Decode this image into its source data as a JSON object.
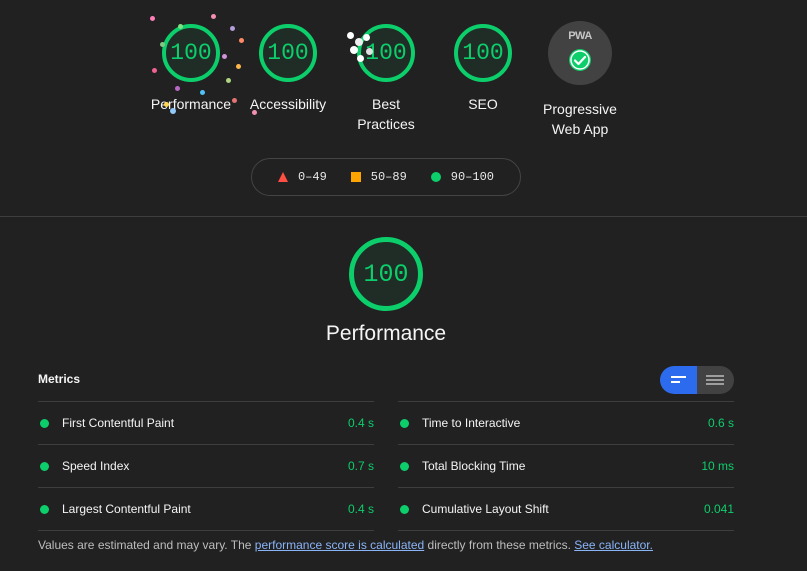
{
  "gauges": [
    {
      "score": "100",
      "label": "Performance"
    },
    {
      "score": "100",
      "label": "Accessibility"
    },
    {
      "score": "100",
      "label": "Best Practices"
    },
    {
      "score": "100",
      "label": "SEO"
    }
  ],
  "pwa": {
    "badge_text": "PWA",
    "label": "Progressive Web App",
    "icon": "check-icon"
  },
  "legend": [
    {
      "icon": "triangle-icon",
      "range": "0–49",
      "color": "#ff4e42"
    },
    {
      "icon": "square-icon",
      "range": "50–89",
      "color": "#ffa400"
    },
    {
      "icon": "circle-icon",
      "range": "90–100",
      "color": "#0cce6b"
    }
  ],
  "category": {
    "score": "100",
    "title": "Performance"
  },
  "metrics": {
    "title": "Metrics",
    "left": [
      {
        "name": "First Contentful Paint",
        "value": "0.4 s"
      },
      {
        "name": "Speed Index",
        "value": "0.7 s"
      },
      {
        "name": "Largest Contentful Paint",
        "value": "0.4 s"
      }
    ],
    "right": [
      {
        "name": "Time to Interactive",
        "value": "0.6 s"
      },
      {
        "name": "Total Blocking Time",
        "value": "10 ms"
      },
      {
        "name": "Cumulative Layout Shift",
        "value": "0.041"
      }
    ]
  },
  "footnote": {
    "prefix": "Values are estimated and may vary. The ",
    "link1": "performance score is calculated",
    "middle": " directly from these metrics. ",
    "link2": "See calculator."
  },
  "colors": {
    "pass": "#0cce6b",
    "toggle_active": "#2c6bed",
    "background": "#212121"
  }
}
